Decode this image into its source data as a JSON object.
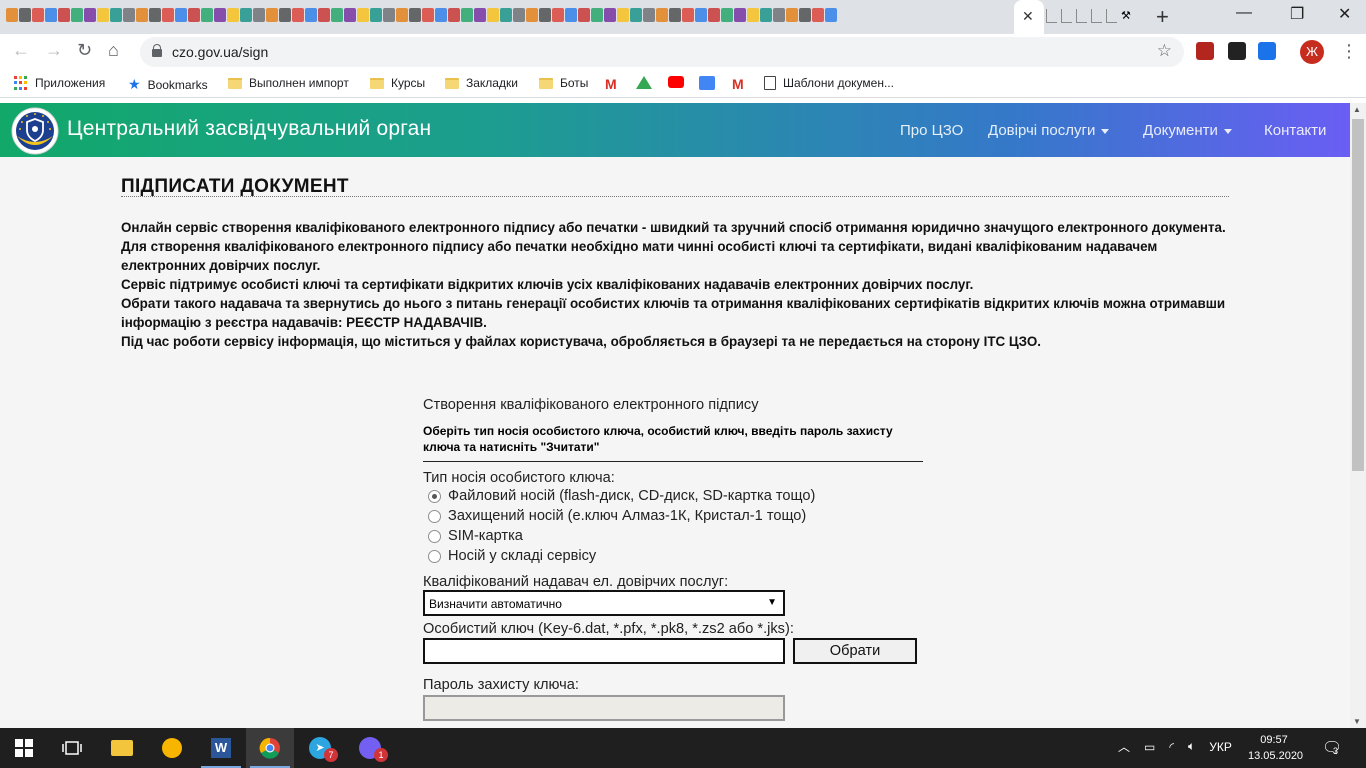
{
  "browser": {
    "url": "czo.gov.ua/sign",
    "active_tab_close": "✕",
    "new_tab": "+",
    "profile_initial": "Ж"
  },
  "bookmarks": [
    {
      "label": "Приложения",
      "icon": "apps-grid-icon"
    },
    {
      "label": "Bookmarks",
      "icon": "star-icon"
    },
    {
      "label": "Выполнен импорт",
      "icon": "folder-icon"
    },
    {
      "label": "Курсы",
      "icon": "folder-icon"
    },
    {
      "label": "Закладки",
      "icon": "folder-icon"
    },
    {
      "label": "Боты",
      "icon": "folder-icon"
    },
    {
      "label": "",
      "icon": "gmail-icon"
    },
    {
      "label": "",
      "icon": "google-drive-icon"
    },
    {
      "label": "",
      "icon": "youtube-icon"
    },
    {
      "label": "",
      "icon": "google-translate-icon"
    },
    {
      "label": "",
      "icon": "gmail-icon"
    },
    {
      "label": "Шаблони докумен...",
      "icon": "document-template-icon"
    }
  ],
  "site": {
    "title": "Центральний засвідчувальний орган",
    "nav": {
      "about": "Про ЦЗО",
      "trust_services": "Довірчі послуги",
      "documents": "Документи",
      "contacts": "Контакти"
    }
  },
  "page": {
    "title": "ПІДПИСАТИ ДОКУМЕНТ",
    "intro": [
      "Онлайн сервіс створення кваліфікованого електронного підпису або печатки - швидкий та зручний спосіб отримання юридично значущого електронного документа.",
      "Для створення кваліфікованого електронного підпису або печатки необхідно мати чинні особисті ключі та сертифікати, видані кваліфікованим надавачем електронних довірчих послуг.",
      "Сервіс підтримує особисті ключі та сертифікати відкритих ключів усіх кваліфікованих надавачів електронних довірчих послуг.",
      "Обрати такого надавача та звернутись до нього з питань генерації особистих ключів та отримання кваліфікованих сертифікатів відкритих ключів можна отримавши інформацію з реєстра надавачів: РЕЄСТР НАДАВАЧІВ.",
      "Під час роботи сервісу інформація, що міститься у файлах користувача, обробляється в браузері та не передається на сторону ІТС ЦЗО."
    ]
  },
  "form": {
    "title": "Створення кваліфікованого електронного підпису",
    "instruction": "Оберіть тип носія особистого ключа, особистий ключ, введіть пароль захисту ключа та натисніть \"Зчитати\"",
    "carrier_label": "Тип носія особистого ключа:",
    "carrier_options": [
      {
        "label": "Файловий носій (flash-диск, CD-диск, SD-картка тощо)",
        "checked": true
      },
      {
        "label": "Захищений носій (е.ключ Алмаз-1К, Кристал-1 тощо)",
        "checked": false
      },
      {
        "label": "SIM-картка",
        "checked": false
      },
      {
        "label": "Носій у складі сервісу",
        "checked": false
      }
    ],
    "provider_label": "Кваліфікований надавач ел. довірчих послуг:",
    "provider_selected": "Визначити автоматично",
    "key_label": "Особистий ключ (Key-6.dat, *.pfx, *.pk8, *.zs2 або *.jks):",
    "key_value": "",
    "choose_button": "Обрати",
    "password_label": "Пароль захисту ключа:"
  },
  "taskbar": {
    "language": "УКР",
    "time": "09:57",
    "date": "13.05.2020",
    "telegram_badge": "7",
    "viber_badge": "1",
    "notifications_count": "3"
  },
  "colors": {
    "header_gradient_start": "#12a86a",
    "header_gradient_end": "#6a5ef4",
    "page_background": "#f5f5f5",
    "taskbar": "#1f1f1f"
  }
}
